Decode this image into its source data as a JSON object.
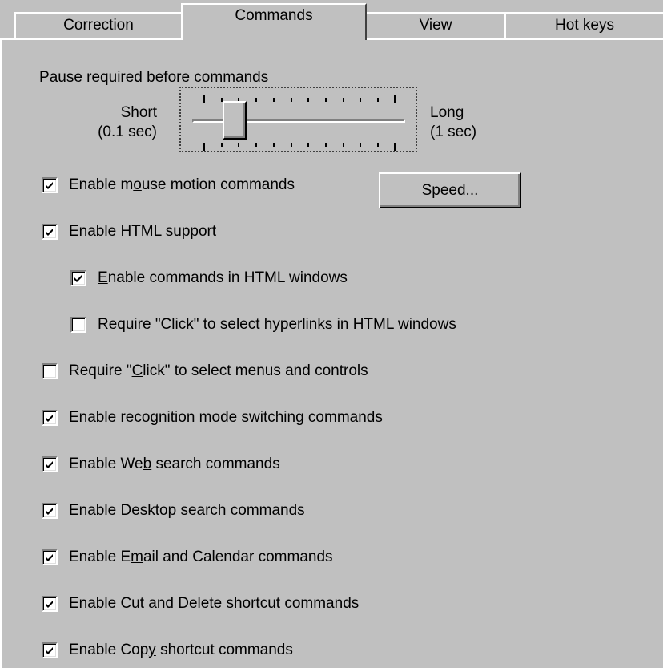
{
  "tabs": [
    {
      "label": "Correction",
      "active": false
    },
    {
      "label": "Commands",
      "active": true
    },
    {
      "label": "View",
      "active": false
    },
    {
      "label": "Hot keys",
      "active": false
    }
  ],
  "pause": {
    "label_pre": "",
    "label_u": "P",
    "label_post": "ause required before commands",
    "short_line1": "Short",
    "short_line2": "(0.1 sec)",
    "long_line1": "Long",
    "long_line2": "(1 sec)"
  },
  "speed_button": {
    "pre": "",
    "u": "S",
    "post": "peed..."
  },
  "options": [
    {
      "pre": "Enable m",
      "u": "o",
      "post": "use motion commands",
      "checked": true
    },
    {
      "pre": "Enable HTML ",
      "u": "s",
      "post": "upport",
      "checked": true
    },
    {
      "pre": "",
      "u": "E",
      "post": "nable commands in HTML windows",
      "checked": true
    },
    {
      "pre": "Require \"Click\" to select ",
      "u": "h",
      "post": "yperlinks in HTML windows",
      "checked": false
    },
    {
      "pre": "Require \"",
      "u": "C",
      "post": "lick\" to select menus and controls",
      "checked": false
    },
    {
      "pre": "Enable recognition mode s",
      "u": "w",
      "post": "itching commands",
      "checked": true
    },
    {
      "pre": "Enable We",
      "u": "b",
      "post": " search commands",
      "checked": true
    },
    {
      "pre": "Enable ",
      "u": "D",
      "post": "esktop search commands",
      "checked": true
    },
    {
      "pre": "Enable E",
      "u": "m",
      "post": "ail and Calendar commands",
      "checked": true
    },
    {
      "pre": "Enable Cu",
      "u": "t",
      "post": " and Delete shortcut commands",
      "checked": true
    },
    {
      "pre": "Enable Copy",
      "u": "",
      "post": "",
      "checked": true
    }
  ],
  "last_option": {
    "pre": "Enable Cop",
    "u": "y",
    "post": " shortcut commands"
  }
}
